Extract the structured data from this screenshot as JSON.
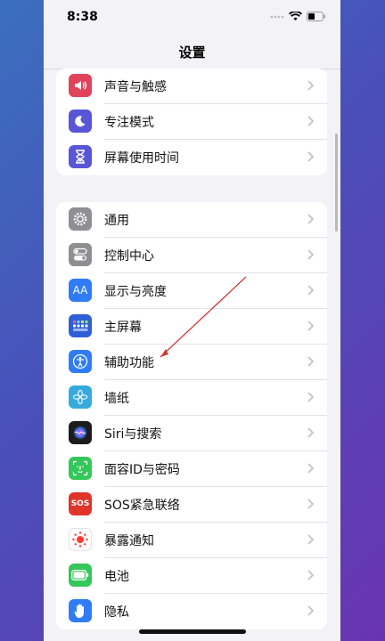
{
  "status_bar": {
    "time": "8:38"
  },
  "nav": {
    "title": "设置"
  },
  "group1": [
    {
      "label": "声音与触感",
      "icon": "speaker-icon",
      "color": "#e0435a"
    },
    {
      "label": "专注模式",
      "icon": "moon-icon",
      "color": "#5856d6"
    },
    {
      "label": "屏幕使用时间",
      "icon": "hourglass-icon",
      "color": "#5856d6"
    }
  ],
  "group2": [
    {
      "label": "通用",
      "icon": "gear-icon",
      "color": "#8e8e93"
    },
    {
      "label": "控制中心",
      "icon": "toggle-icon",
      "color": "#8e8e93"
    },
    {
      "label": "显示与亮度",
      "icon": "text-size-icon",
      "color": "#2f7cf6",
      "glyph": "AA"
    },
    {
      "label": "主屏幕",
      "icon": "home-grid-icon",
      "color": "#2f5fd6"
    },
    {
      "label": "辅助功能",
      "icon": "accessibility-icon",
      "color": "#2f7cf6"
    },
    {
      "label": "墙纸",
      "icon": "flower-icon",
      "color": "#36aadc"
    },
    {
      "label": "Siri与搜索",
      "icon": "siri-icon",
      "color": "#1c1c1e"
    },
    {
      "label": "面容ID与密码",
      "icon": "face-id-icon",
      "color": "#34c759"
    },
    {
      "label": "SOS紧急联络",
      "icon": "sos-icon",
      "color": "#e0352b",
      "glyph": "SOS"
    },
    {
      "label": "暴露通知",
      "icon": "exposure-icon",
      "color": "#ffffff"
    },
    {
      "label": "电池",
      "icon": "battery-icon",
      "color": "#34c759"
    },
    {
      "label": "隐私",
      "icon": "hand-icon",
      "color": "#2f7cf6"
    }
  ]
}
